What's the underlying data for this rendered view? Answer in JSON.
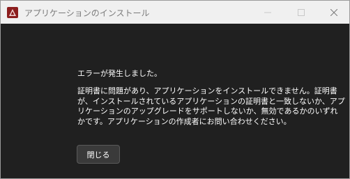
{
  "window": {
    "title": "アプリケーションのインストール",
    "app_icon": "installer-app-icon",
    "controls": {
      "minimize_icon": "minimize-icon",
      "maximize_icon": "maximize-icon",
      "close_icon": "close-icon"
    }
  },
  "dialog": {
    "heading": "エラーが発生しました。",
    "message": "証明書に問題があり、アプリケーションをインストールできません。証明書が、インストールされているアプリケーションの証明書と一致しないか、アプリケーションのアップグレードをサポートしないか、無効であるかのいずれかです。アプリケーションの作成者にお問い合わせください。",
    "close_button_label": "閉じる"
  },
  "colors": {
    "titlebar_bg": "#f0f0f0",
    "content_bg": "#202020",
    "text": "#ffffff",
    "button_bg": "#3a3a3a",
    "app_icon_bg": "#8b1d1d"
  }
}
